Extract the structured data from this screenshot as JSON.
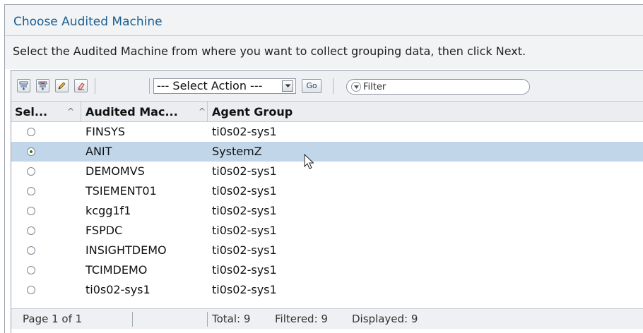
{
  "header": {
    "title": "Choose Audited Machine",
    "description": "Select the Audited Machine from where you want to collect grouping data, then click Next."
  },
  "toolbar": {
    "icons": [
      "select-all-icon",
      "deselect-all-icon",
      "edit-icon",
      "clear-icon"
    ],
    "select_action": "--- Select Action ---",
    "go_label": "Go",
    "filter_placeholder": "Filter"
  },
  "table": {
    "columns": [
      "Sel...",
      "Audited Mac...",
      "Agent Group"
    ],
    "rows": [
      {
        "machine": "FINSYS",
        "group": "ti0s02-sys1",
        "selected": false
      },
      {
        "machine": "ANIT",
        "group": "SystemZ",
        "selected": true
      },
      {
        "machine": "DEMOMVS",
        "group": "ti0s02-sys1",
        "selected": false
      },
      {
        "machine": "TSIEMENT01",
        "group": "ti0s02-sys1",
        "selected": false
      },
      {
        "machine": "kcgg1f1",
        "group": "ti0s02-sys1",
        "selected": false
      },
      {
        "machine": "FSPDC",
        "group": "ti0s02-sys1",
        "selected": false
      },
      {
        "machine": "INSIGHTDEMO",
        "group": "ti0s02-sys1",
        "selected": false
      },
      {
        "machine": "TCIMDEMO",
        "group": "ti0s02-sys1",
        "selected": false
      },
      {
        "machine": "ti0s02-sys1",
        "group": "ti0s02-sys1",
        "selected": false
      }
    ]
  },
  "footer": {
    "page": "Page 1 of 1",
    "total": "Total: 9",
    "filtered": "Filtered: 9",
    "displayed": "Displayed: 9"
  },
  "colors": {
    "title": "#1d5f8f",
    "selected_row": "#c2d6ea"
  }
}
